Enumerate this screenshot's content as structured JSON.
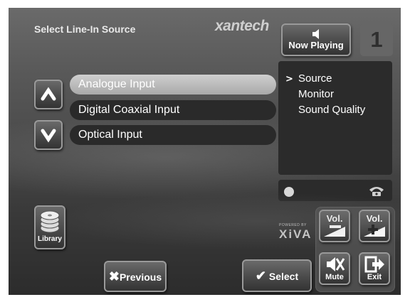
{
  "header": {
    "title": "Select Line-In Source",
    "brand": "xantech"
  },
  "now_playing": {
    "label": "Now Playing",
    "icon": "speaker-icon"
  },
  "zone": {
    "number": "1"
  },
  "menu": {
    "selector": ">",
    "items": [
      "Source",
      "Monitor",
      "Sound Quality"
    ],
    "selected": "Source"
  },
  "sources": {
    "items": [
      "Analogue Input",
      "Digital Coaxial Input",
      "Optical Input"
    ],
    "selected": "Analogue Input"
  },
  "library": {
    "label": "Library",
    "icon": "disc-stack-icon"
  },
  "powered_by": {
    "small": "POWERED BY",
    "brand": "XiVA"
  },
  "volume": {
    "down_label": "Vol.",
    "up_label": "Vol."
  },
  "mute": {
    "label": "Mute"
  },
  "exit": {
    "label": "Exit"
  },
  "actions": {
    "previous_label": "Previous",
    "select_label": "Select"
  },
  "colors": {
    "background": "#4a4a4a",
    "selected_row": "#bdbdbd",
    "panel": "#2b2b2b"
  }
}
